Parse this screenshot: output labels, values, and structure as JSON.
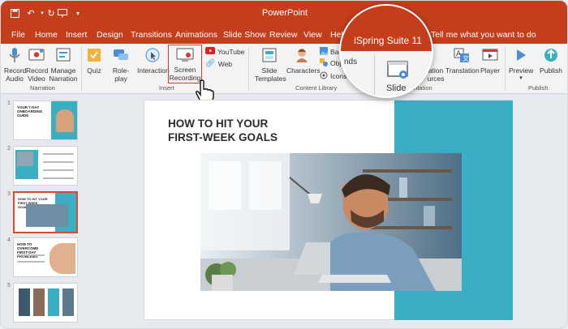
{
  "app": {
    "title": "PowerPoint"
  },
  "titlebar_icons": [
    "save-icon",
    "undo-icon",
    "redo-icon",
    "present-icon",
    "more-icon"
  ],
  "tabs": [
    "File",
    "Home",
    "Insert",
    "Design",
    "Transitions",
    "Animations",
    "Slide Show",
    "Review",
    "View",
    "Help",
    "Tell me what you want to do"
  ],
  "ribbon": {
    "narration": {
      "label": "Narration",
      "buttons": [
        {
          "label": "Record\nAudio",
          "icon": "microphone-icon"
        },
        {
          "label": "Record\nVideo",
          "icon": "record-video-icon"
        },
        {
          "label": "Manage\nNarration",
          "icon": "manage-narration-icon"
        }
      ]
    },
    "insert": {
      "label": "Insert",
      "buttons": [
        {
          "label": "Quiz",
          "icon": "quiz-icon"
        },
        {
          "label": "Role-play",
          "icon": "role-play-icon"
        },
        {
          "label": "Interaction",
          "icon": "interaction-icon"
        },
        {
          "label": "Screen\nRecording",
          "icon": "screen-recording-icon"
        }
      ],
      "small": [
        {
          "label": "YouTube",
          "icon": "youtube-icon"
        },
        {
          "label": "Web",
          "icon": "web-link-icon"
        }
      ]
    },
    "content_library": {
      "label": "Content Library",
      "buttons": [
        {
          "label": "Slide\nTemplates",
          "icon": "slide-templates-icon"
        },
        {
          "label": "Characters",
          "icon": "characters-icon"
        }
      ],
      "small": [
        {
          "label": "Bac",
          "icon": "backgrounds-icon"
        },
        {
          "label": "Obj",
          "icon": "objects-icon"
        },
        {
          "label": "Icons",
          "icon": "icons-icon"
        }
      ]
    },
    "presentation": {
      "label": "entation",
      "buttons": [
        {
          "label": "ation\nurces",
          "icon": "presentation-resources-icon"
        },
        {
          "label": "Translation",
          "icon": "translation-icon"
        },
        {
          "label": "Player",
          "icon": "player-icon"
        }
      ]
    },
    "publish": {
      "label": "Publish",
      "buttons": [
        {
          "label": "Preview",
          "icon": "preview-icon"
        },
        {
          "label": "Publish",
          "icon": "publish-icon"
        }
      ]
    }
  },
  "callout": {
    "title": "iSpring Suite 11",
    "partial_text": "nds",
    "slide_label": "Slide"
  },
  "slides_pane": {
    "numbers": [
      "1",
      "2",
      "3",
      "4",
      "5"
    ],
    "slide1_title": "YOUR 7-DAY ONBOARDING GUIDE",
    "slide3_title": "HOW TO HIT YOUR FIRST-WEEK GOALS",
    "slide4_title": "HOW TO OVERCOME FIRST-DAY PROBLEMS"
  },
  "slide": {
    "title_line1": "HOW TO HIT YOUR",
    "title_line2": "FIRST-WEEK GOALS"
  },
  "colors": {
    "accent": "#c43e1c",
    "teal": "#3aafc3",
    "highlight_box": "#d6382a"
  }
}
